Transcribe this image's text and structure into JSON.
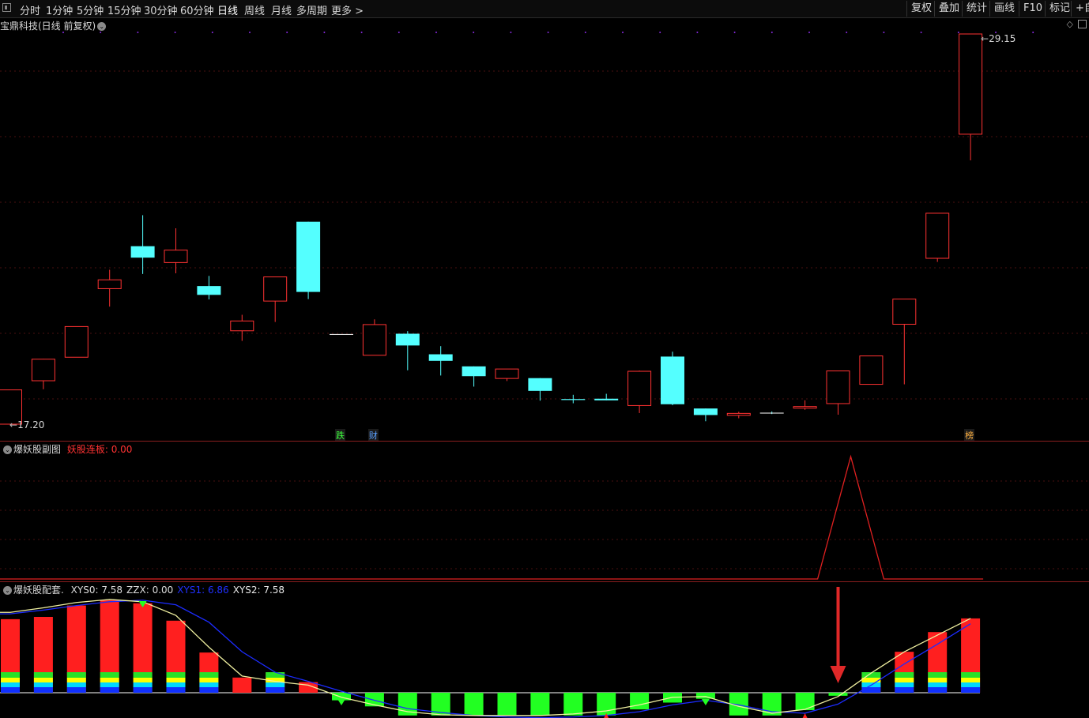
{
  "toolbar": {
    "periods": [
      {
        "label": "分时"
      },
      {
        "label": "1分钟"
      },
      {
        "label": "5分钟"
      },
      {
        "label": "15分钟"
      },
      {
        "label": "30分钟"
      },
      {
        "label": "60分钟"
      },
      {
        "label": "日线"
      },
      {
        "label": "周线"
      },
      {
        "label": "月线"
      },
      {
        "label": "多周期"
      },
      {
        "label": "更多 >"
      }
    ],
    "active": "日线",
    "right_buttons": [
      {
        "label": "复权"
      },
      {
        "label": "叠加"
      },
      {
        "label": "统计"
      },
      {
        "label": "画线"
      },
      {
        "label": "F10"
      },
      {
        "label": "标记"
      },
      {
        "label": "+自"
      }
    ]
  },
  "main_panel": {
    "title": "宝鼎科技(日线 前复权)",
    "high_label": "29.15",
    "low_label": "17.20",
    "events": [
      {
        "label": "跌",
        "index": 10
      },
      {
        "label": "财",
        "index": 11
      },
      {
        "label": "榜",
        "index": 29
      }
    ],
    "colors": {
      "up": "#ff3232",
      "down": "#54ffff"
    }
  },
  "sub_panel1": {
    "title": "爆妖股副图",
    "indicator_label": "妖股连板:",
    "indicator_value": "0.00"
  },
  "sub_panel2": {
    "title": "爆妖股配套.",
    "indicators": [
      {
        "name": "XYS0:",
        "value": "7.58",
        "color": "#dcdcdc"
      },
      {
        "name": "ZZX:",
        "value": "0.00",
        "color": "#dcdcdc"
      },
      {
        "name": "XYS1:",
        "value": "6.86",
        "color": "#2030ff"
      },
      {
        "name": "XYS2:",
        "value": "7.58",
        "color": "#e8e8e8"
      }
    ]
  },
  "chart_data": [
    {
      "type": "candlestick",
      "title": "宝鼎科技(日线 前复权)",
      "ylim": [
        17.2,
        29.15
      ],
      "candles": [
        {
          "o": 17.2,
          "h": 18.25,
          "l": 17.2,
          "c": 18.25
        },
        {
          "o": 18.53,
          "h": 19.2,
          "l": 18.27,
          "c": 19.19
        },
        {
          "o": 19.25,
          "h": 20.19,
          "l": 19.25,
          "c": 20.19
        },
        {
          "o": 21.35,
          "h": 21.93,
          "l": 20.8,
          "c": 21.62
        },
        {
          "o": 22.65,
          "h": 23.6,
          "l": 21.8,
          "c": 22.3
        },
        {
          "o": 22.15,
          "h": 23.2,
          "l": 21.82,
          "c": 22.53
        },
        {
          "o": 21.43,
          "h": 21.74,
          "l": 21.02,
          "c": 21.16
        },
        {
          "o": 20.06,
          "h": 20.55,
          "l": 19.75,
          "c": 20.36
        },
        {
          "o": 20.97,
          "h": 21.1,
          "l": 20.33,
          "c": 21.71
        },
        {
          "o": 23.4,
          "h": 23.4,
          "l": 21.03,
          "c": 21.25
        },
        {
          "o": 19.95,
          "h": 19.95,
          "l": 19.95,
          "c": 19.95
        },
        {
          "o": 19.31,
          "h": 20.41,
          "l": 19.31,
          "c": 20.25
        },
        {
          "o": 19.97,
          "h": 20.05,
          "l": 18.85,
          "c": 19.61
        },
        {
          "o": 19.34,
          "h": 19.59,
          "l": 18.69,
          "c": 19.14
        },
        {
          "o": 18.97,
          "h": 18.97,
          "l": 18.35,
          "c": 18.67
        },
        {
          "o": 18.6,
          "h": 18.85,
          "l": 18.52,
          "c": 18.89
        },
        {
          "o": 18.61,
          "h": 18.61,
          "l": 17.92,
          "c": 18.22
        },
        {
          "o": 17.97,
          "h": 18.1,
          "l": 17.84,
          "c": 17.94
        },
        {
          "o": 17.98,
          "h": 18.13,
          "l": 17.97,
          "c": 17.93
        },
        {
          "o": 17.77,
          "h": 18.84,
          "l": 17.54,
          "c": 18.82
        },
        {
          "o": 19.27,
          "h": 19.42,
          "l": 17.78,
          "c": 17.81
        },
        {
          "o": 17.68,
          "h": 17.48,
          "l": 17.29,
          "c": 17.48
        },
        {
          "o": 17.47,
          "h": 17.58,
          "l": 17.38,
          "c": 17.53
        },
        {
          "o": 17.54,
          "h": 17.59,
          "l": 17.51,
          "c": 17.53
        },
        {
          "o": 17.69,
          "h": 17.93,
          "l": 17.64,
          "c": 17.74
        },
        {
          "o": 17.83,
          "h": 18.47,
          "l": 17.49,
          "c": 18.83
        },
        {
          "o": 18.42,
          "h": 19.28,
          "l": 18.42,
          "c": 19.29
        },
        {
          "o": 20.26,
          "h": 21.03,
          "l": 18.42,
          "c": 21.03
        },
        {
          "o": 22.28,
          "h": 22.33,
          "l": 22.17,
          "c": 23.66
        },
        {
          "o": 26.08,
          "h": 29.15,
          "l": 25.28,
          "c": 29.15
        }
      ]
    },
    {
      "type": "line",
      "title": "爆妖股副图",
      "series": [
        {
          "name": "妖股连板",
          "values": [
            0,
            0,
            0,
            0,
            0,
            0,
            0,
            0,
            0,
            0,
            0,
            0,
            0,
            0,
            0,
            0,
            0,
            0,
            0,
            0,
            0,
            0,
            0,
            0,
            0,
            1,
            0,
            0,
            0,
            0
          ]
        }
      ]
    },
    {
      "type": "bar",
      "title": "爆妖股配套.",
      "x_count": 30,
      "ylim": [
        -10,
        10
      ],
      "series": [
        {
          "name": "bars",
          "values": [
            9.7,
            10.0,
            11.5,
            12.2,
            11.8,
            9.5,
            5.3,
            2.0,
            2.6,
            1.4,
            -1.0,
            -1.8,
            -3.0,
            -3.0,
            -3.0,
            -3.0,
            -3.0,
            -3.0,
            -3.0,
            -2.2,
            -1.3,
            -0.8,
            -3.0,
            -3.0,
            -2.3,
            -0.4,
            2.7,
            5.4,
            8.0,
            9.8
          ]
        },
        {
          "name": "XYS0",
          "values": [
            10.6,
            11.2,
            11.9,
            12.3,
            12.0,
            10.2,
            6.0,
            2.2,
            1.5,
            1.0,
            -0.6,
            -1.6,
            -2.5,
            -2.9,
            -3.0,
            -3.0,
            -3.0,
            -2.8,
            -2.4,
            -1.6,
            -0.6,
            -0.5,
            -1.8,
            -2.7,
            -2.2,
            -0.5,
            2.6,
            5.4,
            7.6,
            9.8
          ]
        },
        {
          "name": "XYS1",
          "values": [
            10.4,
            10.9,
            11.5,
            12.0,
            12.2,
            11.6,
            9.3,
            5.4,
            2.7,
            1.5,
            0.2,
            -1.0,
            -2.1,
            -2.6,
            -3.0,
            -3.2,
            -3.3,
            -3.2,
            -3.0,
            -2.5,
            -1.6,
            -1.0,
            -1.6,
            -2.5,
            -2.7,
            -1.5,
            1.0,
            3.8,
            6.4,
            9.1
          ]
        },
        {
          "name": "XYS2",
          "values": [
            10.6,
            11.2,
            11.9,
            12.3,
            12.0,
            10.2,
            6.0,
            2.2,
            1.5,
            1.0,
            -0.6,
            -1.6,
            -2.5,
            -2.9,
            -3.0,
            -3.0,
            -3.0,
            -2.8,
            -2.4,
            -1.6,
            -0.6,
            -0.5,
            -1.8,
            -2.7,
            -2.2,
            -0.5,
            2.6,
            5.4,
            7.6,
            9.8
          ]
        }
      ],
      "markers": {
        "green_down": [
          4,
          10,
          21
        ],
        "red_up": [
          18,
          24
        ],
        "arrow_down": 25
      }
    }
  ]
}
